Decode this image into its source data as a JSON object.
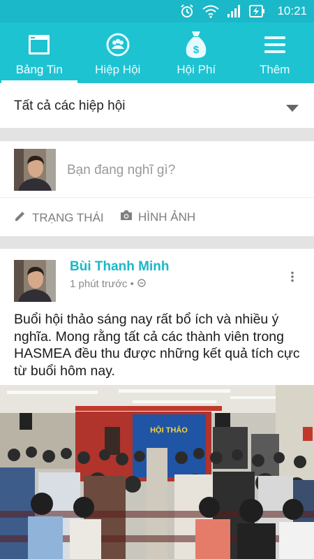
{
  "status_bar": {
    "time": "10:21",
    "icons": [
      "alarm-icon",
      "wifi-icon",
      "signal-icon",
      "battery-charging-icon"
    ]
  },
  "tabs": [
    {
      "label": "Bảng Tin",
      "icon": "newsfeed-icon",
      "active": true
    },
    {
      "label": "Hiệp Hội",
      "icon": "association-icon",
      "active": false
    },
    {
      "label": "Hội Phí",
      "icon": "money-bag-icon",
      "active": false
    },
    {
      "label": "Thêm",
      "icon": "menu-icon",
      "active": false
    }
  ],
  "filter": {
    "selected": "Tất cả các hiệp hội"
  },
  "composer": {
    "placeholder": "Bạn đang nghĩ gì?",
    "status_label": "TRẠNG THÁI",
    "photo_label": "HÌNH ẢNH"
  },
  "post": {
    "author": "Bùi Thanh Minh",
    "time": "1 phút trước •",
    "text": "Buổi hội thảo sáng nay rất bổ ích và nhiều ý nghĩa. Mong rằng tất cả các thành viên trong HASMEA đều thu được những kết quả tích cực từ buổi hôm nay.",
    "photo": {
      "banner_title": "HỘI THẢO"
    }
  },
  "colors": {
    "accent": "#1ec3d2",
    "status_bar": "#1ab8c8",
    "author": "#1ab8c8"
  }
}
